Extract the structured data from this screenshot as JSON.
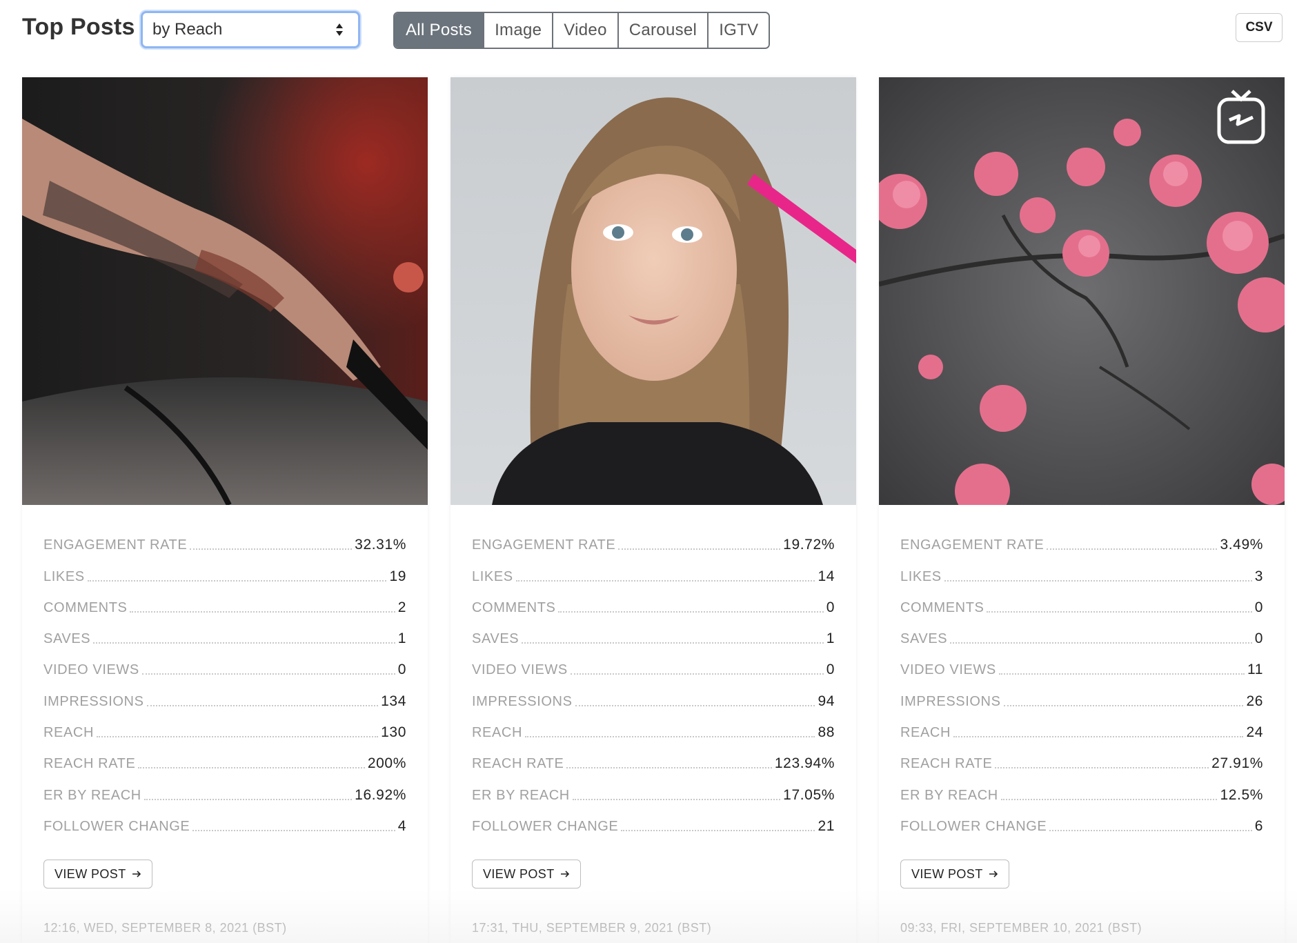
{
  "header": {
    "title": "Top Posts",
    "sort_select": {
      "value": "by Reach"
    },
    "filter_tabs": [
      "All Posts",
      "Image",
      "Video",
      "Carousel",
      "IGTV"
    ],
    "active_filter": "All Posts",
    "csv_label": "CSV"
  },
  "posts": [
    {
      "image": "tattooed-hand-holding-microphone",
      "stats": [
        {
          "label": "ENGAGEMENT RATE",
          "value": "32.31%"
        },
        {
          "label": "LIKES",
          "value": "19"
        },
        {
          "label": "COMMENTS",
          "value": "2"
        },
        {
          "label": "SAVES",
          "value": "1"
        },
        {
          "label": "VIDEO VIEWS",
          "value": "0"
        },
        {
          "label": "IMPRESSIONS",
          "value": "134"
        },
        {
          "label": "REACH",
          "value": "130"
        },
        {
          "label": "REACH RATE",
          "value": "200%"
        },
        {
          "label": "ER BY REACH",
          "value": "16.92%"
        },
        {
          "label": "FOLLOWER CHANGE",
          "value": "4"
        }
      ],
      "view_label": "VIEW POST",
      "date": "12:16, WED, SEPTEMBER 8, 2021 (BST)"
    },
    {
      "image": "woman-portrait-pink-pen",
      "stats": [
        {
          "label": "ENGAGEMENT RATE",
          "value": "19.72%"
        },
        {
          "label": "LIKES",
          "value": "14"
        },
        {
          "label": "COMMENTS",
          "value": "0"
        },
        {
          "label": "SAVES",
          "value": "1"
        },
        {
          "label": "VIDEO VIEWS",
          "value": "0"
        },
        {
          "label": "IMPRESSIONS",
          "value": "94"
        },
        {
          "label": "REACH",
          "value": "88"
        },
        {
          "label": "REACH RATE",
          "value": "123.94%"
        },
        {
          "label": "ER BY REACH",
          "value": "17.05%"
        },
        {
          "label": "FOLLOWER CHANGE",
          "value": "21"
        }
      ],
      "view_label": "VIEW POST",
      "date": "17:31, THU, SEPTEMBER 9, 2021 (BST)"
    },
    {
      "image": "pink-flowers-branch",
      "badge": "igtv-icon",
      "stats": [
        {
          "label": "ENGAGEMENT RATE",
          "value": "3.49%"
        },
        {
          "label": "LIKES",
          "value": "3"
        },
        {
          "label": "COMMENTS",
          "value": "0"
        },
        {
          "label": "SAVES",
          "value": "0"
        },
        {
          "label": "VIDEO VIEWS",
          "value": "11"
        },
        {
          "label": "IMPRESSIONS",
          "value": "26"
        },
        {
          "label": "REACH",
          "value": "24"
        },
        {
          "label": "REACH RATE",
          "value": "27.91%"
        },
        {
          "label": "ER BY REACH",
          "value": "12.5%"
        },
        {
          "label": "FOLLOWER CHANGE",
          "value": "6"
        }
      ],
      "view_label": "VIEW POST",
      "date": "09:33, FRI, SEPTEMBER 10, 2021 (BST)"
    }
  ],
  "colors": {
    "active_tab": "#6b747c",
    "select_focus": "#8fb6f2",
    "label_gray": "#a0a0a0"
  }
}
